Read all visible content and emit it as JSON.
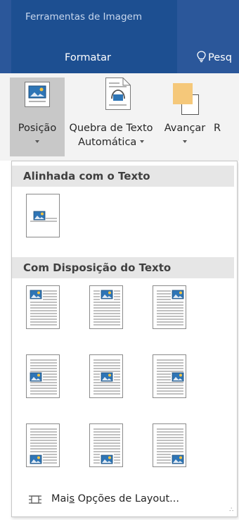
{
  "ribbon": {
    "context_group": "Ferramentas de Imagem",
    "active_tab": "Formatar",
    "tell_me": "Pesq"
  },
  "toolbar": {
    "position": "Posição",
    "wrap_line1": "Quebra de Texto",
    "wrap_line2": "Automática",
    "forward": "Avançar",
    "cut_label": "R"
  },
  "menu": {
    "section_inline": "Alinhada com o Texto",
    "section_wrap": "Com Disposição do Texto",
    "more_prefix": "Mai",
    "more_underlined": "s",
    "more_suffix": " Opções de Layout..."
  },
  "colors": {
    "ribbon_blue": "#2b579a",
    "context_blue": "#1d4f91",
    "picture_blue": "#2e75b6",
    "sun_yellow": "#f5c342"
  },
  "positions_grid": [
    "top-left",
    "top-center",
    "top-right",
    "middle-left",
    "middle-center",
    "middle-right",
    "bottom-left",
    "bottom-center",
    "bottom-right"
  ]
}
